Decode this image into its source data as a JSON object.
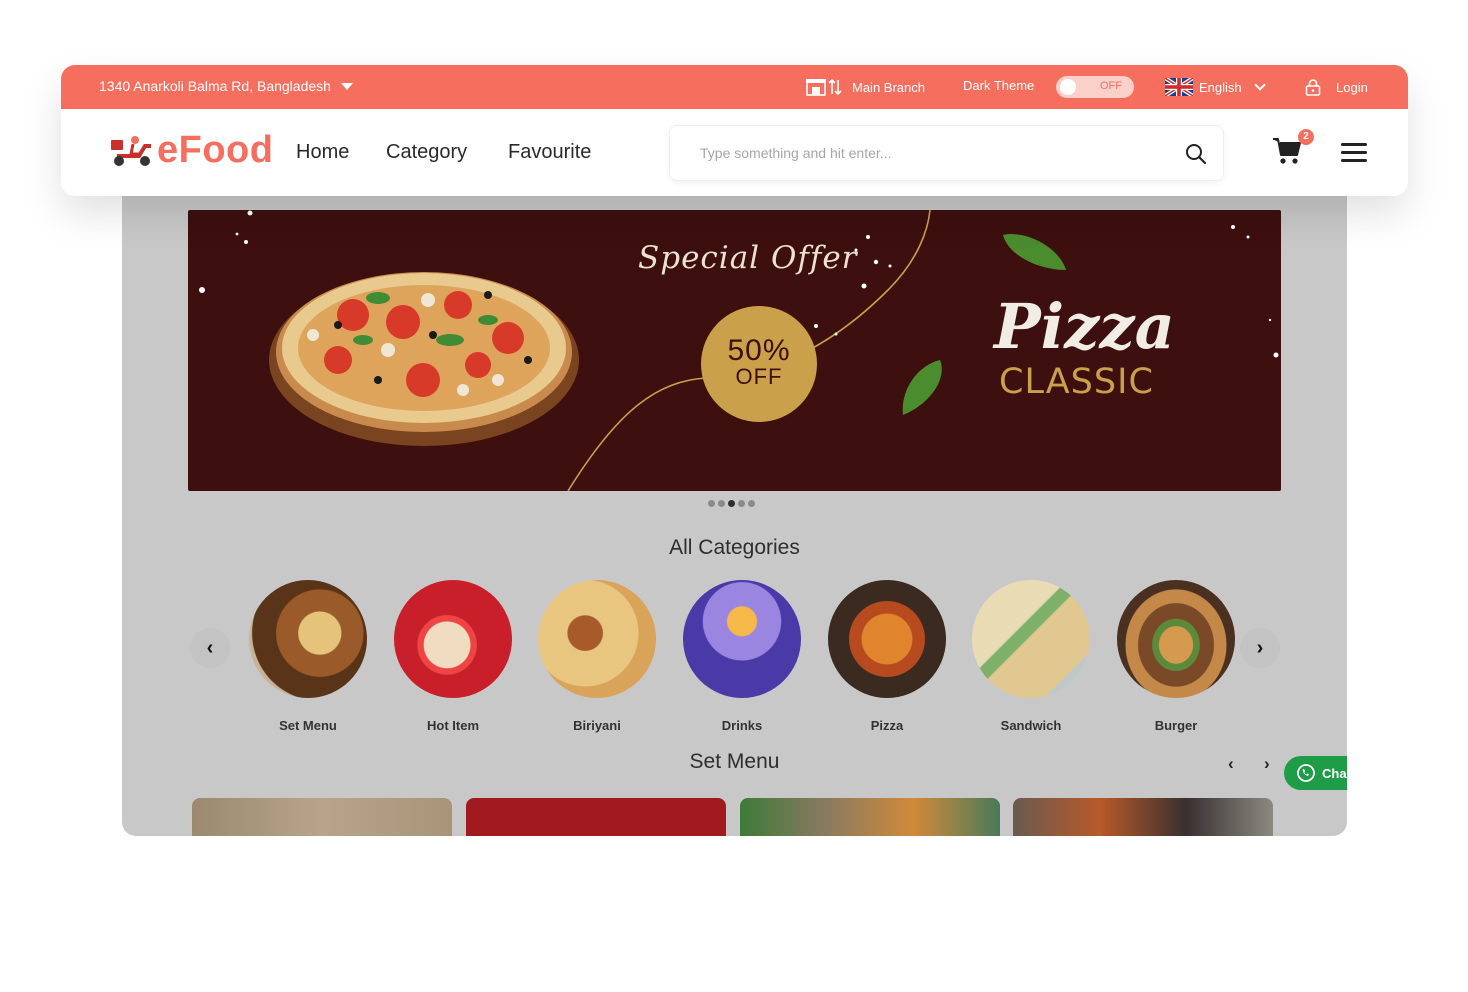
{
  "topbar": {
    "address": "1340 Anarkoli Balma Rd, Bangladesh",
    "branch": "Main Branch",
    "dark_theme_label": "Dark Theme",
    "dark_theme_state": "OFF",
    "language": "English",
    "login": "Login"
  },
  "nav": {
    "brand": "eFood",
    "links": [
      "Home",
      "Category",
      "Favourite"
    ],
    "search_placeholder": "Type something and hit enter...",
    "cart_count": "2"
  },
  "banner": {
    "special": "Special Offer",
    "percent": "50%",
    "off": "OFF",
    "title": "Pizza",
    "subtitle": "CLASSIC",
    "slides": 5,
    "active_slide": 3
  },
  "categories": {
    "title": "All Categories",
    "items": [
      {
        "name": "Set Menu",
        "color": "#b78a5a"
      },
      {
        "name": "Hot Item",
        "color": "#c81f2a"
      },
      {
        "name": "Biriyani",
        "color": "#d9a35a"
      },
      {
        "name": "Drinks",
        "color": "#6a58c8"
      },
      {
        "name": "Pizza",
        "color": "#a3351e"
      },
      {
        "name": "Sandwich",
        "color": "#d8c48e"
      },
      {
        "name": "Burger",
        "color": "#6d4428"
      }
    ]
  },
  "set_menu": {
    "title": "Set Menu",
    "chat_label": "Cha"
  },
  "colors": {
    "brand": "#f66f5e",
    "banner_bg": "#3d0f0f",
    "gold": "#caa04a",
    "whatsapp": "#1e9c47"
  }
}
